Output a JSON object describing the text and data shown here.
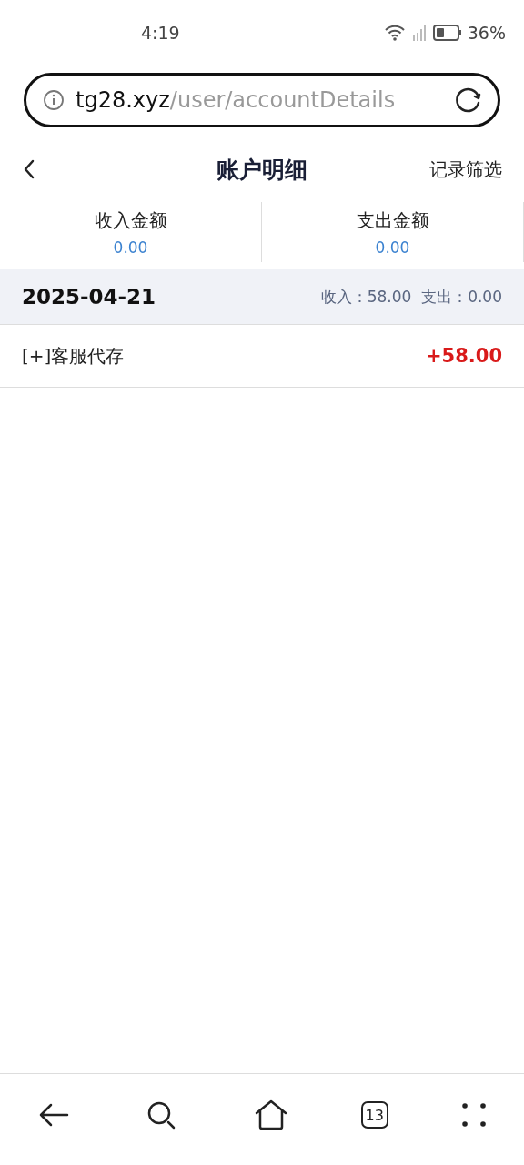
{
  "status_bar": {
    "time": "4:19",
    "battery": "36%"
  },
  "address_bar": {
    "domain": "tg28.xyz",
    "path": "/user/accountDetails"
  },
  "header": {
    "title": "账户明细",
    "action": "记录筛选"
  },
  "summary": [
    {
      "label": "收入金额",
      "value": "0.00"
    },
    {
      "label": "支出金额",
      "value": "0.00"
    }
  ],
  "days": [
    {
      "date": "2025-04-21",
      "totals": "收入：58.00  支出：0.00",
      "entries": [
        {
          "name": "[+]客服代存",
          "amount": "+58.00"
        }
      ]
    }
  ],
  "bottom_nav": {
    "tab_count": "13"
  }
}
